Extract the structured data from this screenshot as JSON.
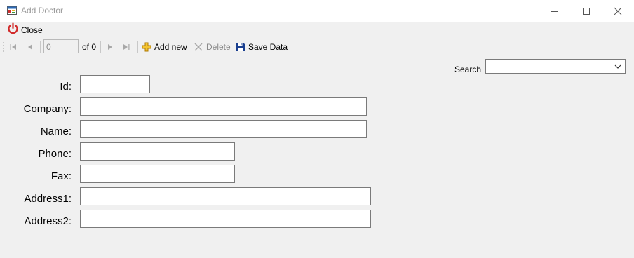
{
  "window": {
    "title": "Add Doctor",
    "icon": "form-app-icon",
    "controls": [
      "minimize-icon",
      "maximize-icon",
      "close-icon"
    ]
  },
  "menu": {
    "close_label": "Close",
    "close_icon": "power-icon",
    "close_icon_color": "#d12a2a"
  },
  "navigator": {
    "position_value": "0",
    "count_label": "of 0",
    "add_label": "Add new",
    "delete_label": "Delete",
    "save_label": "Save Data",
    "add_icon_color": "#e0a000",
    "save_icon_color": "#1a3f8f"
  },
  "search": {
    "label": "Search",
    "value": ""
  },
  "form": {
    "fields": [
      {
        "label": "Id:",
        "value": ""
      },
      {
        "label": "Company:",
        "value": ""
      },
      {
        "label": "Name:",
        "value": ""
      },
      {
        "label": "Phone:",
        "value": ""
      },
      {
        "label": "Fax:",
        "value": ""
      },
      {
        "label": "Address1:",
        "value": ""
      },
      {
        "label": "Address2:",
        "value": ""
      }
    ]
  }
}
